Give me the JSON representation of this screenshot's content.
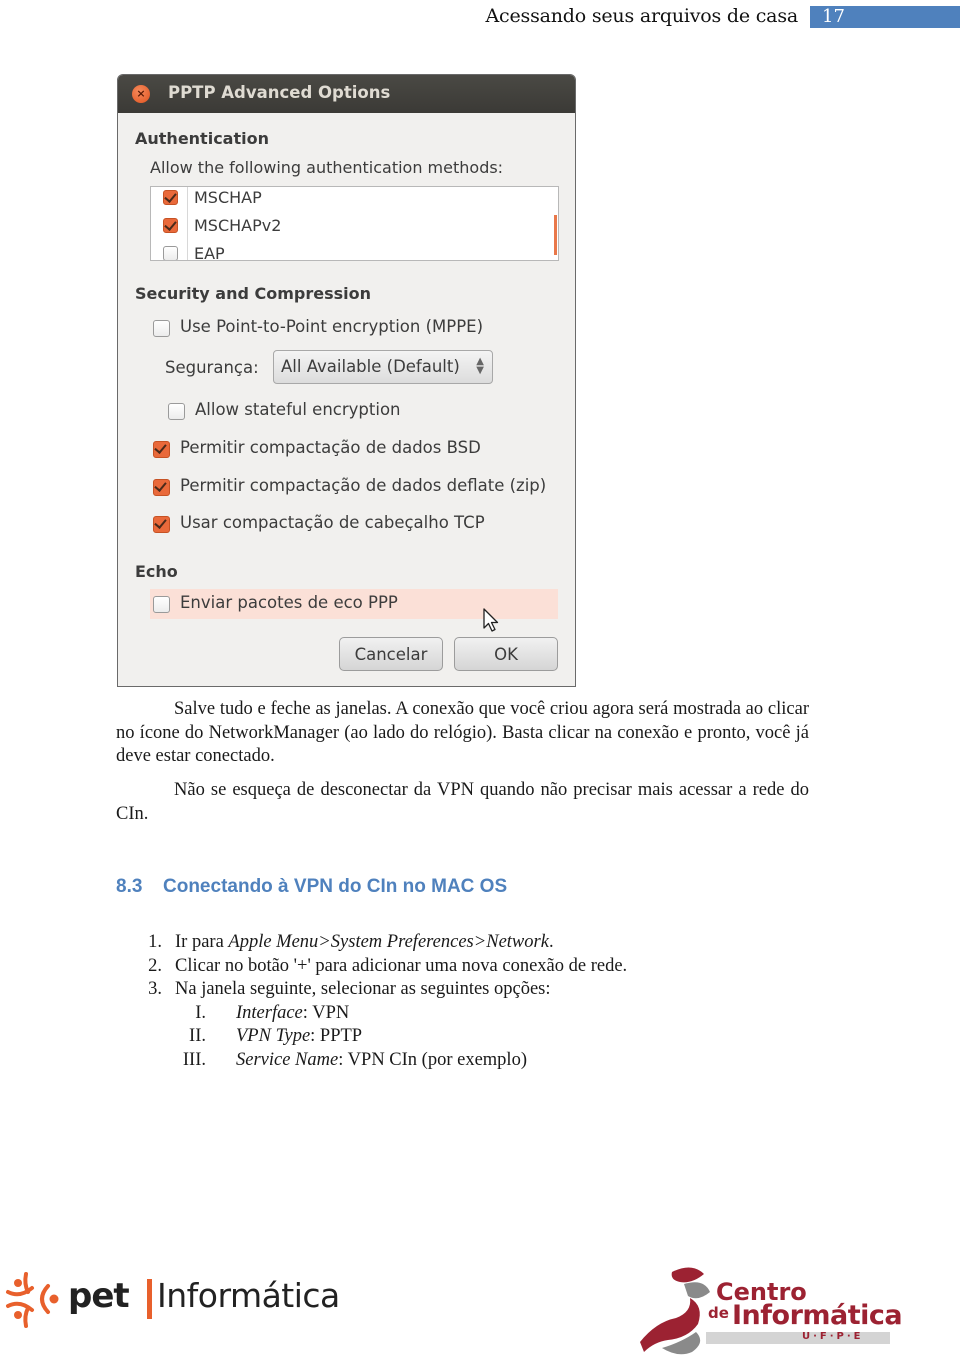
{
  "header": {
    "title": "Acessando seus arquivos de casa",
    "page_number": "17",
    "accent_color": "#4f81bd"
  },
  "dialog": {
    "title": "PPTP Advanced Options",
    "close_icon": "close-icon",
    "authentication": {
      "heading": "Authentication",
      "label": "Allow the following authentication methods:",
      "methods": [
        {
          "label": "MSCHAP",
          "checked": true
        },
        {
          "label": "MSCHAPv2",
          "checked": true
        },
        {
          "label": "EAP",
          "checked": false
        }
      ]
    },
    "security": {
      "heading": "Security and Compression",
      "mppe": {
        "label": "Use Point-to-Point encryption (MPPE)",
        "checked": false
      },
      "seguranca_label": "Segurança:",
      "seguranca_value": "All Available (Default)",
      "stateful": {
        "label": "Allow stateful encryption",
        "checked": false
      },
      "bsd": {
        "label": "Permitir compactação de dados BSD",
        "checked": true
      },
      "deflate": {
        "label": "Permitir compactação de dados deflate (zip)",
        "checked": true
      },
      "tcp": {
        "label": "Usar compactação de cabeçalho TCP",
        "checked": true
      }
    },
    "echo": {
      "heading": "Echo",
      "ppp": {
        "label": "Enviar pacotes de eco PPP",
        "checked": false
      }
    },
    "buttons": {
      "cancel": "Cancelar",
      "ok": "OK"
    },
    "accent_color": "#e9693a"
  },
  "body": {
    "para1": "Salve tudo e feche as janelas. A conexão que você criou agora será mostrada ao clicar no ícone do NetworkManager (ao lado do relógio). Basta clicar na conexão e pronto, você já deve estar conectado.",
    "para2": "Não se esqueça de desconectar da VPN quando não precisar mais acessar a rede do CIn.",
    "section": {
      "number": "8.3",
      "title": "Conectando à VPN do CIn no MAC OS"
    },
    "steps": [
      {
        "n": "1.",
        "prefix": "Ir para ",
        "italic": "Apple Menu>System Preferences>Network",
        "suffix": "."
      },
      {
        "n": "2.",
        "prefix": "Clicar no botão '+' para adicionar uma nova conexão de rede.",
        "italic": "",
        "suffix": ""
      },
      {
        "n": "3.",
        "prefix": "Na janela seguinte, selecionar as seguintes opções:",
        "italic": "",
        "suffix": ""
      }
    ],
    "substeps": [
      {
        "n": "I.",
        "italic": "Interface",
        "suffix": ": VPN"
      },
      {
        "n": "II.",
        "italic": "VPN Type",
        "suffix": ": PPTP"
      },
      {
        "n": "III.",
        "italic": "Service Name",
        "suffix": ": VPN CIn (por exemplo)"
      }
    ]
  },
  "footer": {
    "left_logo": {
      "word1": "pet",
      "word2": "Informática",
      "color": "#e8602c"
    },
    "right_logo": {
      "line1": "Centro",
      "de": "de",
      "line2": "Informática",
      "sub": "U·F·P·E",
      "color": "#9c2232"
    }
  }
}
